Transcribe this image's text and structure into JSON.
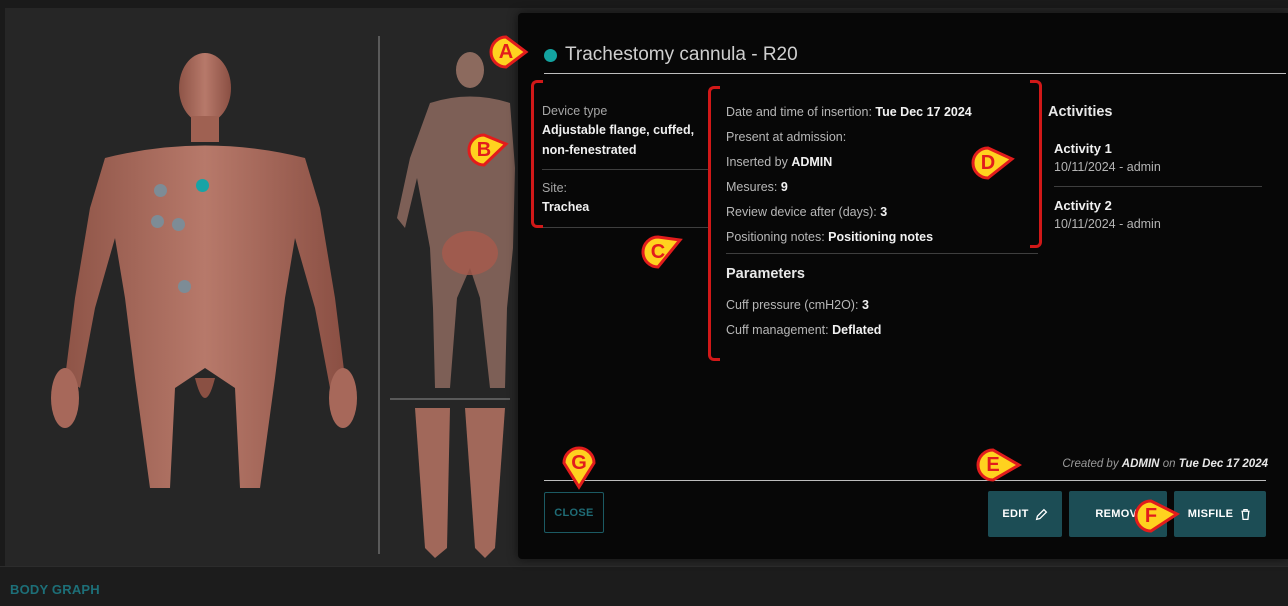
{
  "footer": {
    "label": "BODY GRAPH"
  },
  "modal": {
    "title": "Trachestomy cannula - R20",
    "status_color": "#13a3a0",
    "device_type_label": "Device type",
    "device_type_value": "Adjustable flange, cuffed, non-fenestrated",
    "site_label": "Site:",
    "site_value": "Trachea",
    "info": {
      "insertion_label": "Date and time of insertion:",
      "insertion_value": "Tue Dec 17 2024",
      "present_label": "Present at admission:",
      "inserted_by_label": "Inserted by",
      "inserted_by_value": "ADMIN",
      "mesures_label": "Mesures:",
      "mesures_value": "9",
      "review_label": "Review device after (days):",
      "review_value": "3",
      "notes_label": "Positioning notes:",
      "notes_value": "Positioning notes"
    },
    "parameters": {
      "heading": "Parameters",
      "cuff_pressure_label": "Cuff pressure (cmH2O):",
      "cuff_pressure_value": "3",
      "cuff_mgmt_label": "Cuff management:",
      "cuff_mgmt_value": "Deflated"
    },
    "activities": {
      "heading": "Activities",
      "items": [
        {
          "name": "Activity 1",
          "sub": "10/11/2024 - admin"
        },
        {
          "name": "Activity 2",
          "sub": "10/11/2024 - admin"
        }
      ]
    },
    "created": {
      "prefix": "Created by",
      "user": "ADMIN",
      "on": "on",
      "date": "Tue Dec 17 2024"
    },
    "buttons": {
      "close": "CLOSE",
      "edit": "EDIT",
      "remove": "REMOVI",
      "misfile": "MISFILE"
    }
  },
  "callouts": [
    "A",
    "B",
    "C",
    "D",
    "E",
    "F",
    "G"
  ],
  "colors": {
    "accent": "#1c4d55",
    "callout": "#e21c1c",
    "callout_fill": "#ffd21f",
    "skin": "#b67565"
  }
}
